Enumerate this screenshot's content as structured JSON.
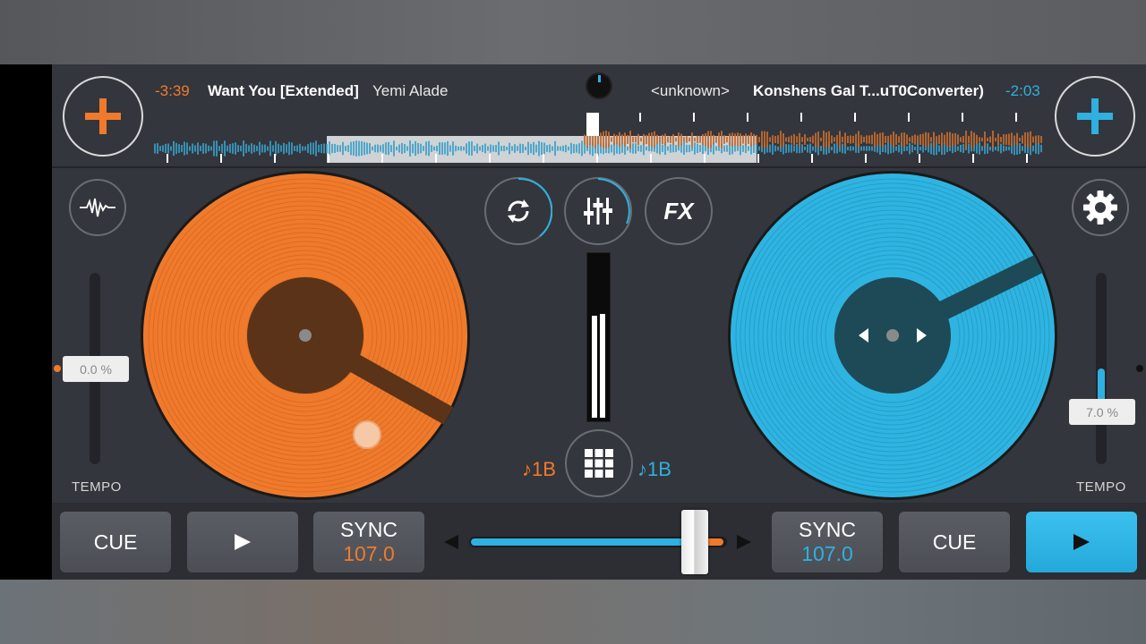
{
  "deck_left": {
    "time_remaining": "-3:39",
    "track_title": "Want You [Extended]",
    "artist": "Yemi Alade",
    "tempo_value": "0.0 %",
    "tempo_label": "TEMPO",
    "beat_indicator": "♪1B",
    "cue_label": "CUE",
    "sync_label": "SYNC",
    "bpm": "107.0",
    "accent_color": "#f07a2c"
  },
  "deck_right": {
    "time_remaining": "-2:03",
    "track_title": "Konshens Gal T...uT0Converter)",
    "artist": "<unknown>",
    "tempo_value": "7.0 %",
    "tempo_label": "TEMPO",
    "beat_indicator": "♪1B",
    "cue_label": "CUE",
    "sync_label": "SYNC",
    "bpm": "107.0",
    "accent_color": "#2fb0e0"
  },
  "center": {
    "fx_label": "FX"
  },
  "crossfader": {
    "position": 0.83
  },
  "icons": {
    "add_left": "plus-icon",
    "add_right": "plus-icon",
    "waveform": "waveform-icon",
    "settings": "gear-icon",
    "loop": "loop-icon",
    "mixer": "equalizer-icon",
    "sampler": "grid-icon",
    "play": "play-icon"
  }
}
